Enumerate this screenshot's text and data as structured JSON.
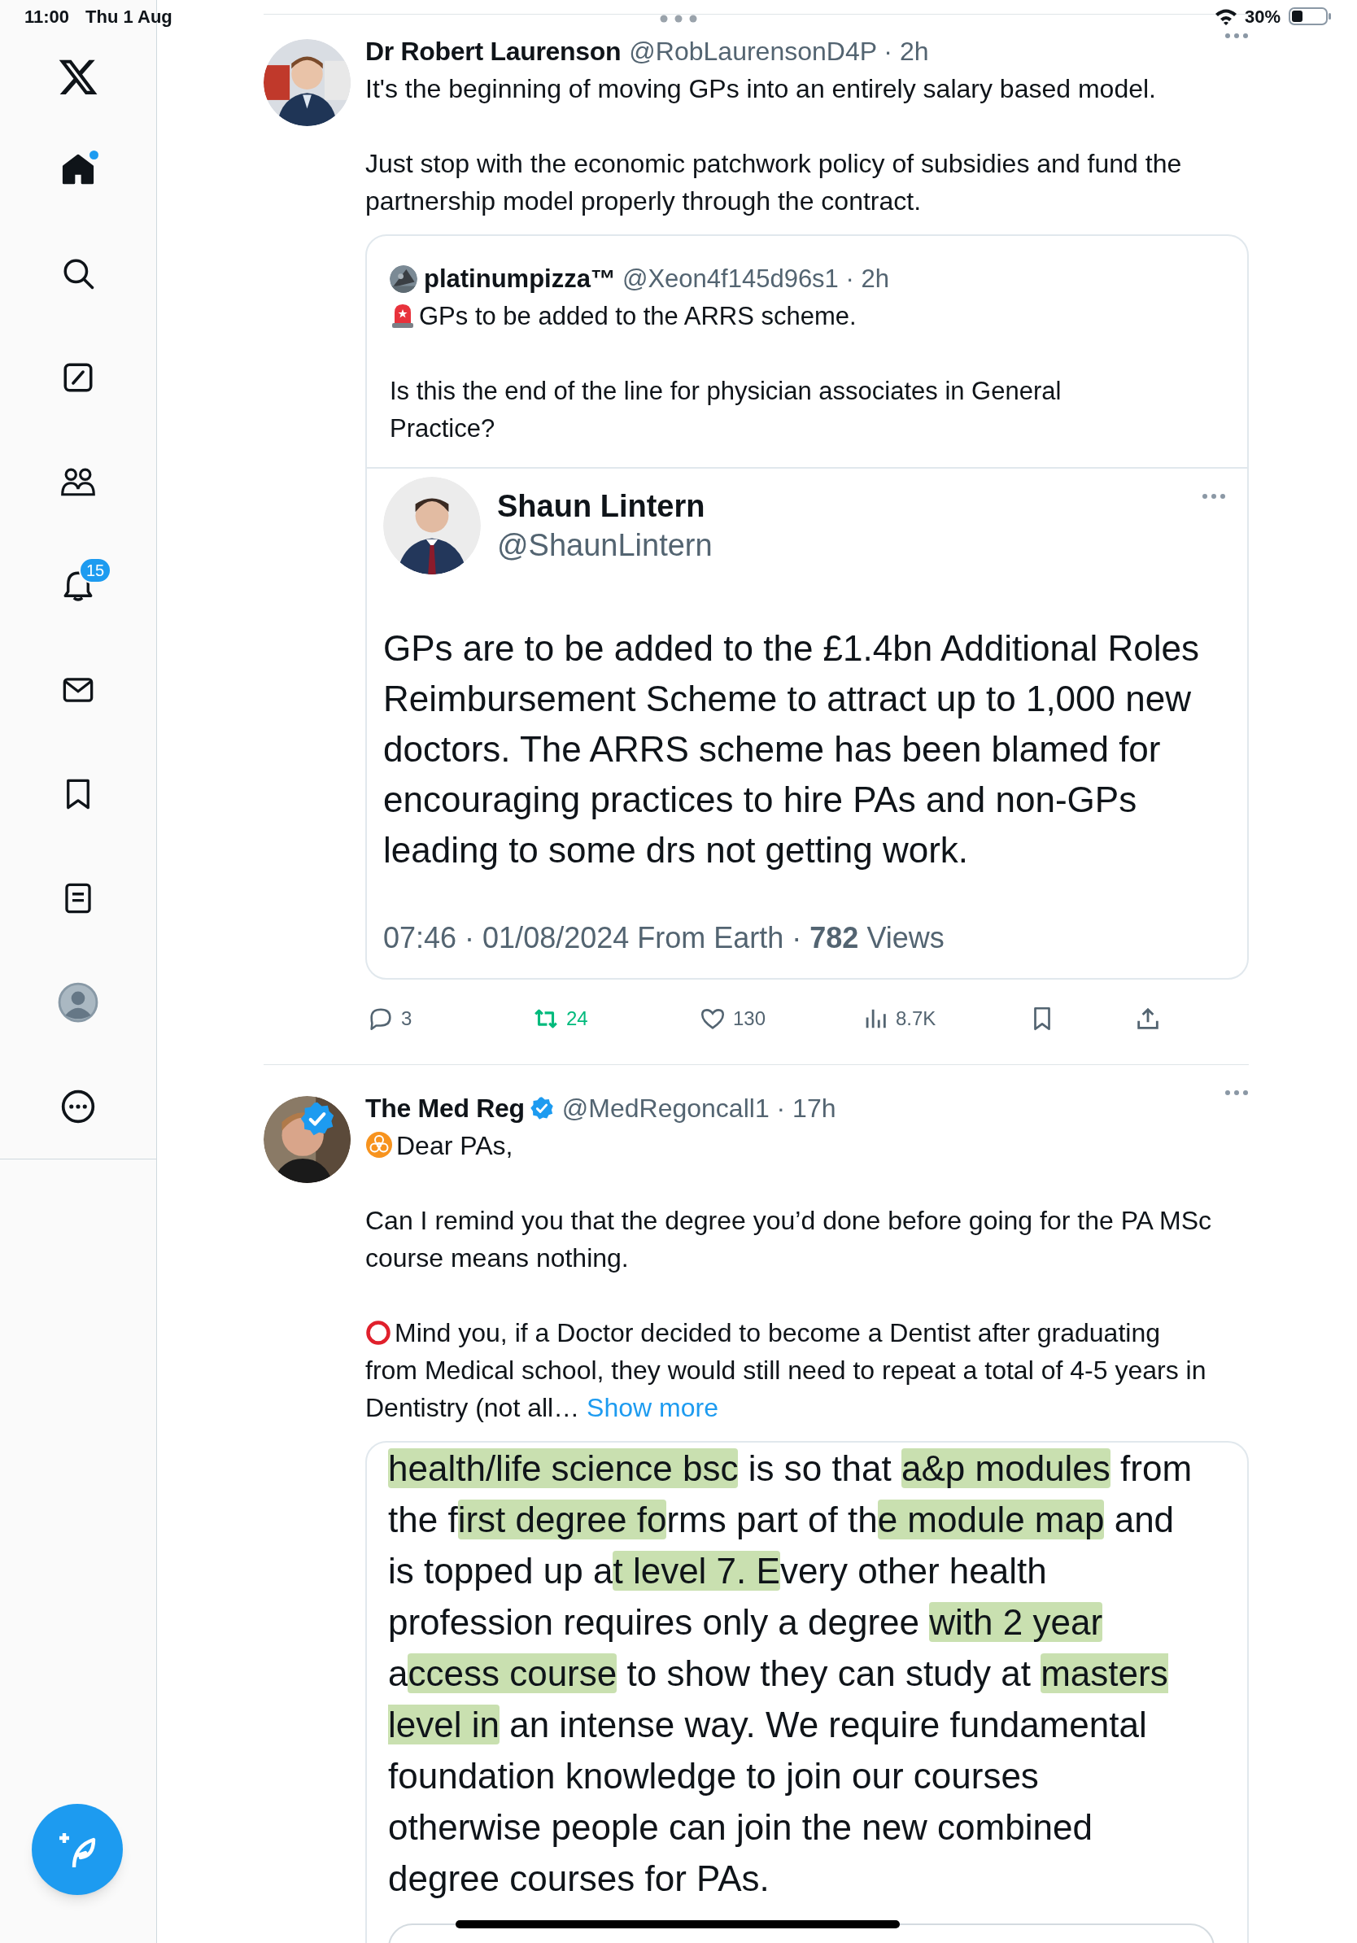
{
  "status_bar": {
    "time": "11:00",
    "date": "Thu 1 Aug",
    "battery": "30%"
  },
  "sidebar": {
    "items": [
      {
        "kind": "home",
        "selected": true,
        "unread": true
      },
      {
        "kind": "search",
        "selected": false,
        "unread": false
      },
      {
        "kind": "compose",
        "selected": false,
        "unread": false
      },
      {
        "kind": "communities",
        "selected": false,
        "unread": false
      },
      {
        "kind": "notifications",
        "selected": false,
        "unread": false,
        "badge": "15"
      },
      {
        "kind": "messages",
        "selected": false,
        "unread": false
      },
      {
        "kind": "bookmarks",
        "selected": false,
        "unread": false
      },
      {
        "kind": "lists",
        "selected": false,
        "unread": false
      },
      {
        "kind": "profile",
        "selected": false,
        "unread": false
      },
      {
        "kind": "more",
        "selected": false,
        "unread": false
      }
    ]
  },
  "tweets": [
    {
      "author": "Dr Robert Laurenson",
      "verified": false,
      "meta": "@RobLaurensonD4P · 2h",
      "paragraphs": [
        {
          "text": "It's the beginning of moving GPs into an entirely salary based model.",
          "kind": "plain"
        },
        {
          "text": "Just stop with the economic patchwork policy of subsidies and fund the partnership model properly through the contract.",
          "kind": "plain"
        }
      ],
      "quote": {
        "author": "platinumpizza™",
        "meta": "@Xeon4f145d96s1 · 2h",
        "paragraphs": [
          {
            "text": "GPs to be added to the ARRS scheme.",
            "kind": "siren"
          },
          {
            "text": "Is this the end of the line for physician associates in General Practice?",
            "kind": "plain"
          }
        ],
        "media": {
          "kind": "tweet_screenshot",
          "author": "Shaun Lintern",
          "handle": "@ShaunLintern",
          "text": "GPs are to be added to the £1.4bn Additional Roles Reimbursement Scheme to attract up to 1,000 new doctors. The ARRS scheme has been blamed for encouraging practices to hire PAs and non-GPs leading to some drs not getting work.",
          "footer": "07:46 · 01/08/2024 From Earth · **782** Views"
        }
      },
      "actions": [
        {
          "kind": "reply",
          "count": "3",
          "active": false
        },
        {
          "kind": "repost",
          "count": "24",
          "active": true
        },
        {
          "kind": "like",
          "count": "130",
          "active": false
        },
        {
          "kind": "views",
          "count": "8.7K",
          "active": false
        },
        {
          "kind": "bookmark",
          "active": false
        },
        {
          "kind": "share",
          "active": false
        }
      ]
    },
    {
      "author": "The Med Reg",
      "verified": true,
      "meta": "@MedRegoncall1 · 17h",
      "paragraphs": [
        {
          "text": "Dear PAs,",
          "kind": "biohazard"
        },
        {
          "text": "Can I remind you that the degree you’d done before going for the PA MSc course means nothing.",
          "kind": "plain"
        },
        {
          "text": "Mind you, if a Doctor decided to become a Dentist after graduating from Medical school, they would still need to repeat a total of 4-5 years in Dentistry (not all…",
          "kind": "ring",
          "link": "Show more"
        }
      ],
      "quote": {
        "media": {
          "kind": "text_screenshot",
          "segments": [
            {
              "text": "health/life science bsc",
              "highlighted": true
            },
            {
              "text": " is so that ",
              "highlighted": false
            },
            {
              "text": "a&p modules",
              "highlighted": true
            },
            {
              "text": " from the f",
              "highlighted": false
            },
            {
              "text": "irst degree fo",
              "highlighted": true
            },
            {
              "text": "rms part of th",
              "highlighted": false
            },
            {
              "text": "e module map",
              "highlighted": true
            },
            {
              "text": " and is topped up a",
              "highlighted": false
            },
            {
              "text": "t level 7. E",
              "highlighted": true
            },
            {
              "text": "very other health profession requires only a degree ",
              "highlighted": false
            },
            {
              "text": "with 2 year",
              "highlighted": true
            },
            {
              "text": " a",
              "highlighted": false
            },
            {
              "text": "ccess course",
              "highlighted": true
            },
            {
              "text": " to show they can study at ",
              "highlighted": false
            },
            {
              "text": "masters level in",
              "highlighted": true
            },
            {
              "text": " an intense way. We require fundamental foundation knowledge to join our courses otherwise people can join the new combined degree courses for PAs.",
              "highlighted": false
            }
          ]
        }
      }
    }
  ]
}
